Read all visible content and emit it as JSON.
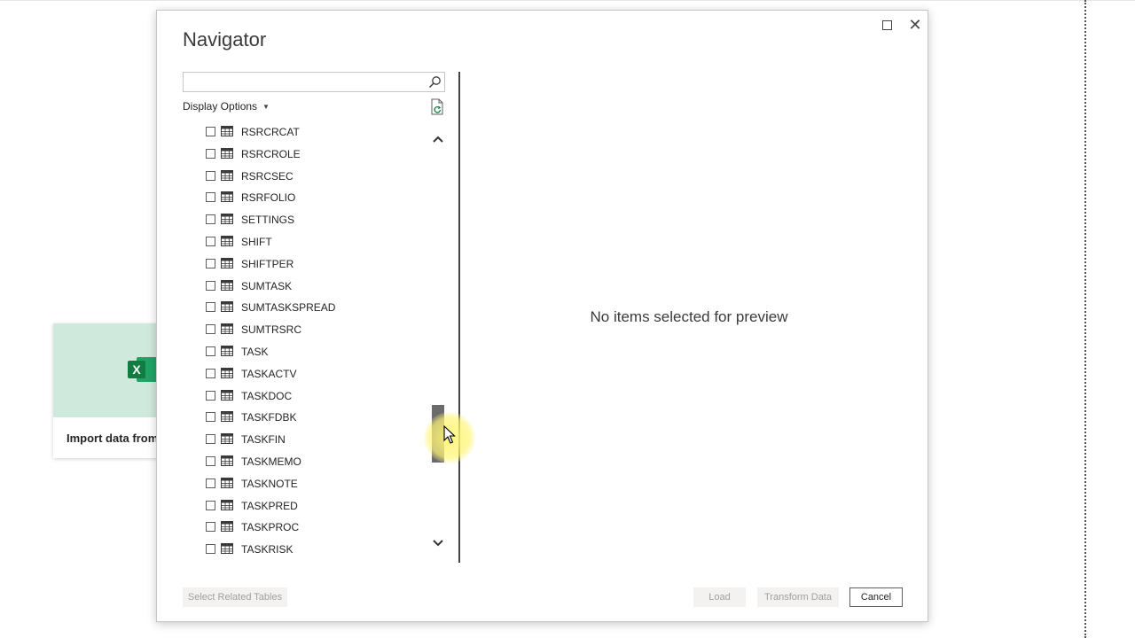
{
  "background": {
    "card_label": "Import data from",
    "excel_letter": "X",
    "excel_color": "#107c41"
  },
  "dialog": {
    "title": "Navigator",
    "close_glyph": "✕",
    "search": {
      "value": "",
      "placeholder": ""
    },
    "display_options_label": "Display Options",
    "table_items": [
      "RSRCRCAT",
      "RSRCROLE",
      "RSRCSEC",
      "RSRFOLIO",
      "SETTINGS",
      "SHIFT",
      "SHIFTPER",
      "SUMTASK",
      "SUMTASKSPREAD",
      "SUMTRSRC",
      "TASK",
      "TASKACTV",
      "TASKDOC",
      "TASKFDBK",
      "TASKFIN",
      "TASKMEMO",
      "TASKNOTE",
      "TASKPRED",
      "TASKPROC",
      "TASKRISK"
    ],
    "preview_message": "No items selected for preview",
    "buttons": {
      "select_related": "Select Related Tables",
      "load": "Load",
      "transform": "Transform Data",
      "cancel": "Cancel"
    }
  }
}
